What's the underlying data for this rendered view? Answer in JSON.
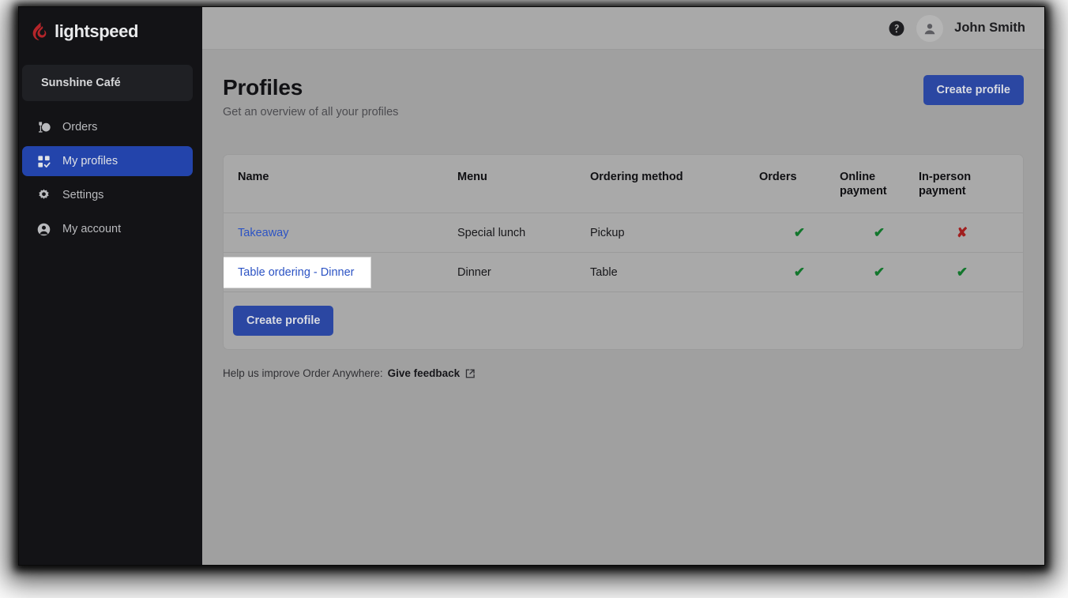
{
  "brand": {
    "name": "lightspeed",
    "logo_icon": "lightspeed-flame-logo"
  },
  "sidebar": {
    "store": "Sunshine Café",
    "items": [
      {
        "label": "Orders",
        "icon": "orders-icon",
        "active": false
      },
      {
        "label": "My profiles",
        "icon": "profiles-icon",
        "active": true
      },
      {
        "label": "Settings",
        "icon": "gear-icon",
        "active": false
      },
      {
        "label": "My account",
        "icon": "user-circle-icon",
        "active": false
      }
    ]
  },
  "topbar": {
    "help_icon": "help-circle-icon",
    "avatar_icon": "user-avatar-icon",
    "user_name": "John Smith"
  },
  "page": {
    "title": "Profiles",
    "subtitle": "Get an overview of all your profiles",
    "create_button": "Create profile"
  },
  "table": {
    "columns": [
      "Name",
      "Menu",
      "Ordering method",
      "Orders",
      "Online\npayment",
      "In-person\npayment"
    ],
    "columns_line1": [
      "Name",
      "Menu",
      "Ordering method",
      "Orders",
      "Online",
      "In-person"
    ],
    "columns_line2": [
      "",
      "",
      "",
      "",
      "payment",
      "payment"
    ],
    "rows": [
      {
        "name": "Takeaway",
        "menu": "Special lunch",
        "ordering_method": "Pickup",
        "orders": "check",
        "online_payment": "check",
        "in_person_payment": "cross",
        "action_icon": "open-in-new-icon",
        "highlighted": false
      },
      {
        "name": "Table ordering - Dinner",
        "menu": "Dinner",
        "ordering_method": "Table",
        "orders": "check",
        "online_payment": "check",
        "in_person_payment": "check",
        "action_icon": "open-in-new-icon",
        "highlighted": true
      }
    ],
    "footer_button": "Create profile"
  },
  "footer": {
    "text": "Help us improve Order Anywhere:",
    "link": "Give feedback",
    "link_icon": "open-in-new-icon"
  },
  "colors": {
    "accent_blue": "#2b47a2",
    "link_blue": "#2c53c4",
    "sidebar_bg": "#131316",
    "page_bg": "#a0a0a0",
    "card_bg": "#a9a9a9",
    "check_green": "#12762c",
    "cross_red": "#a11f1f",
    "logo_red": "#b5252a"
  }
}
